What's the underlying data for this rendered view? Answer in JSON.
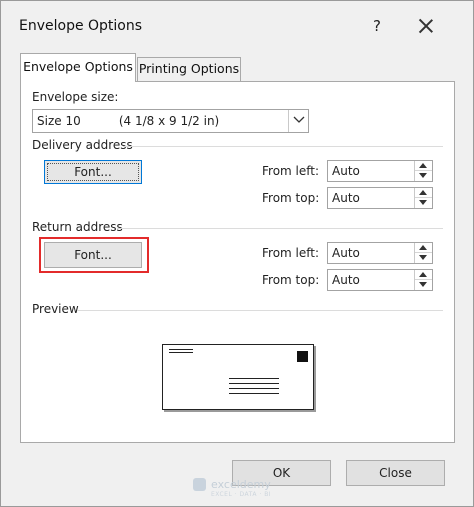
{
  "window": {
    "title": "Envelope Options",
    "help_label": "?",
    "close_icon": "close-icon"
  },
  "tabs": [
    {
      "label": "Envelope Options",
      "active": true
    },
    {
      "label": "Printing Options",
      "active": false
    }
  ],
  "envelope_size": {
    "label": "Envelope size:",
    "value": "Size 10          (4 1/8 x 9 1/2 in)"
  },
  "delivery": {
    "section_label": "Delivery address",
    "font_button": "Font...",
    "from_left_label": "From left:",
    "from_left_value": "Auto",
    "from_top_label": "From top:",
    "from_top_value": "Auto"
  },
  "return": {
    "section_label": "Return address",
    "font_button": "Font...",
    "from_left_label": "From left:",
    "from_left_value": "Auto",
    "from_top_label": "From top:",
    "from_top_value": "Auto"
  },
  "preview": {
    "section_label": "Preview"
  },
  "footer": {
    "ok_label": "OK",
    "close_label": "Close"
  },
  "watermark": {
    "text": "exceldemy",
    "sub": "EXCEL · DATA · BI"
  },
  "colors": {
    "highlight": "#e32b2b",
    "focus": "#0078d7"
  }
}
